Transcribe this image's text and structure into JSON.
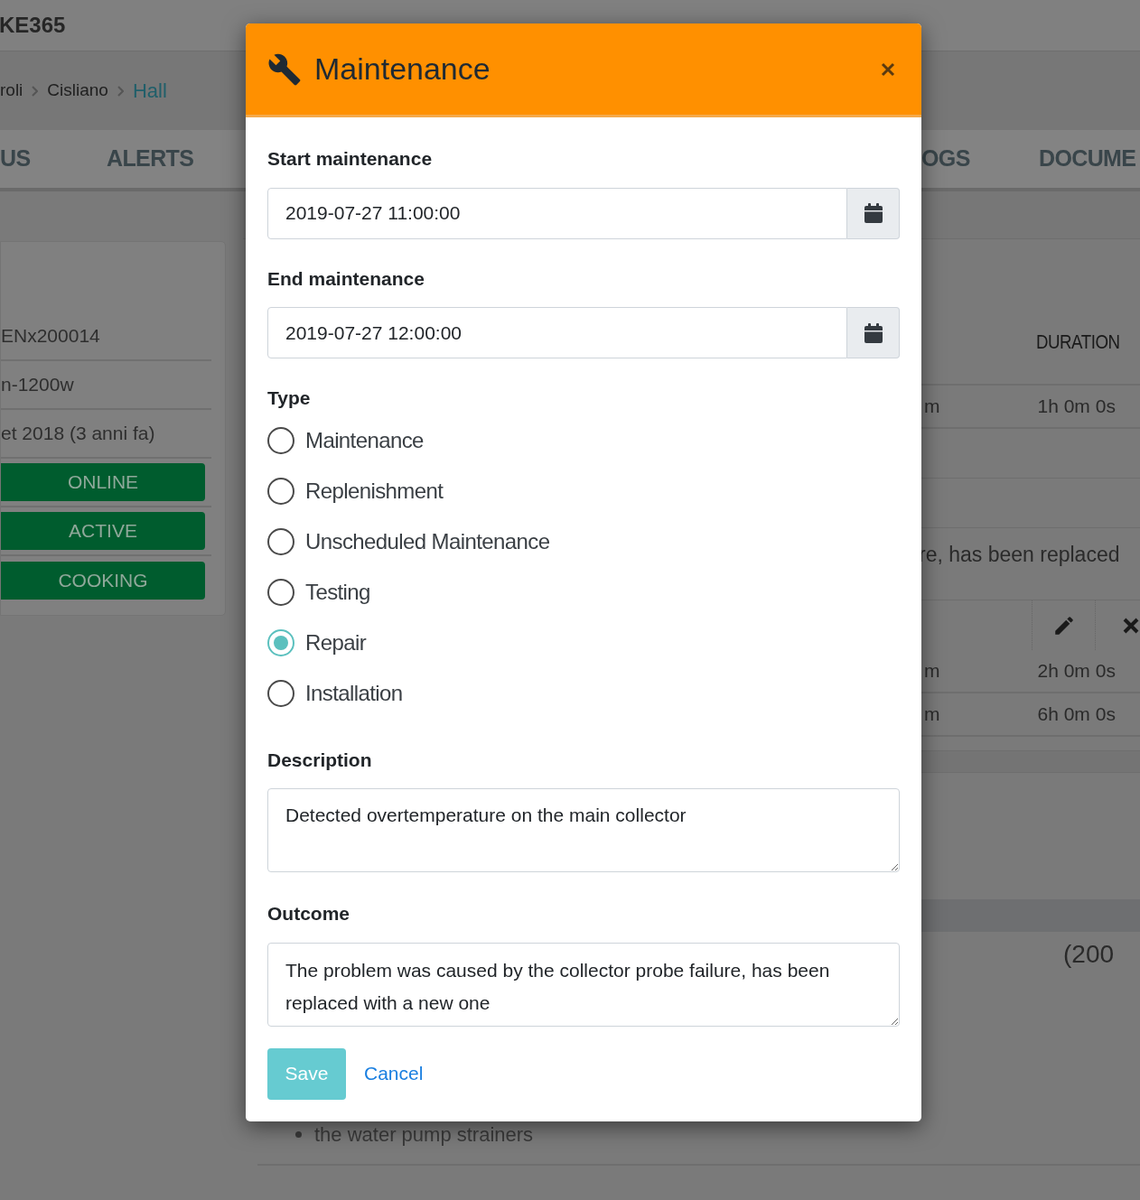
{
  "app": {
    "brand": "KE365"
  },
  "breadcrumb": [
    {
      "label": "roli",
      "current": false
    },
    {
      "label": "Cisliano",
      "current": false
    },
    {
      "label": "Hall",
      "current": true
    }
  ],
  "tabs": [
    {
      "label": "US"
    },
    {
      "label": "ALERTS"
    },
    {
      "label": "OGS"
    },
    {
      "label": "DOCUME"
    }
  ],
  "device_card": {
    "rows": [
      "ENx200014",
      "n-1200w",
      "et 2018 (3 anni fa)"
    ],
    "badges": [
      "ONLINE",
      "ACTIVE",
      "COOKING"
    ]
  },
  "log_table": {
    "column_header": "DURATION",
    "rows": [
      {
        "kind": "entry",
        "column_1": "m",
        "duration": "1h 0m 0s"
      },
      {
        "kind": "blank"
      },
      {
        "kind": "blank"
      },
      {
        "kind": "note",
        "text": "re, has been replaced"
      },
      {
        "kind": "actions"
      },
      {
        "kind": "entry",
        "column_1": "m",
        "duration": "2h 0m 0s"
      },
      {
        "kind": "entry",
        "column_1": "m",
        "duration": "6h 0m 0s"
      }
    ]
  },
  "hours_label": "(200",
  "checklist": [
    "the water pump strainers"
  ],
  "modal": {
    "title": "Maintenance",
    "start": {
      "label": "Start maintenance",
      "value": "2019-07-27 11:00:00"
    },
    "end": {
      "label": "End maintenance",
      "value": "2019-07-27 12:00:00"
    },
    "type": {
      "label": "Type",
      "options": [
        {
          "label": "Maintenance",
          "selected": false
        },
        {
          "label": "Replenishment",
          "selected": false
        },
        {
          "label": "Unscheduled Maintenance",
          "selected": false
        },
        {
          "label": "Testing",
          "selected": false
        },
        {
          "label": "Repair",
          "selected": true
        },
        {
          "label": "Installation",
          "selected": false
        }
      ]
    },
    "description": {
      "label": "Description",
      "value": "Detected overtemperature on the main collector"
    },
    "outcome": {
      "label": "Outcome",
      "value": "The problem was caused by the collector probe failure, has been replaced with a new one"
    },
    "save": "Save",
    "cancel": "Cancel"
  }
}
